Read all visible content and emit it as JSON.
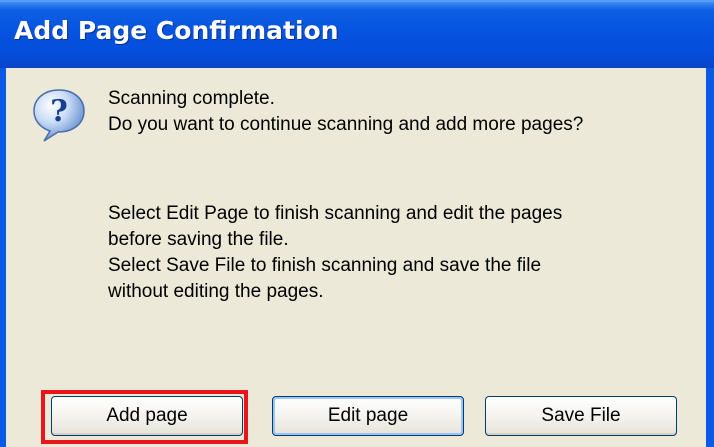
{
  "dialog": {
    "title": "Add Page Confirmation",
    "icon": "question-icon",
    "message_lines": [
      "Scanning complete.",
      "Do you want to continue scanning and add more pages?"
    ],
    "detail_lines": [
      "Select Edit Page to finish scanning and edit the pages",
      "before saving the file.",
      "Select Save File to finish scanning and save the file",
      "without editing the pages."
    ]
  },
  "buttons": {
    "add_label": "Add page",
    "edit_label": "Edit page",
    "save_label": "Save File"
  },
  "colors": {
    "titlebar": "#0553e0",
    "client": "#ece9d8",
    "highlight": "#e8151b"
  }
}
